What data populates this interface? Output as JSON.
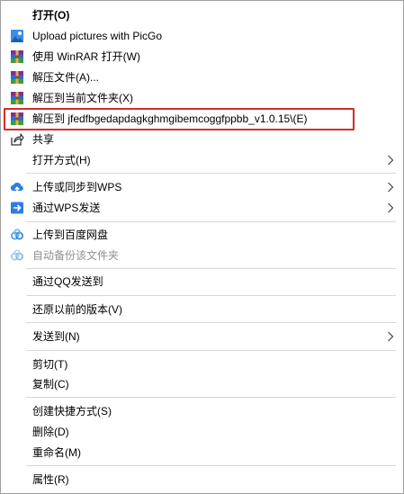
{
  "menu": {
    "items": [
      {
        "id": "open",
        "label": "打开(O)"
      },
      {
        "id": "picgo",
        "label": "Upload pictures with PicGo"
      },
      {
        "id": "winrar-open",
        "label": "使用 WinRAR 打开(W)"
      },
      {
        "id": "extract-files",
        "label": "解压文件(A)..."
      },
      {
        "id": "extract-here",
        "label": "解压到当前文件夹(X)"
      },
      {
        "id": "extract-to-folder",
        "label": "解压到 jfedfbgedapdagkghmgibemcoggfppbb_v1.0.15\\(E)"
      },
      {
        "id": "share",
        "label": "共享"
      },
      {
        "id": "open-with",
        "label": "打开方式(H)"
      },
      {
        "id": "wps-upload",
        "label": "上传或同步到WPS"
      },
      {
        "id": "wps-send",
        "label": "通过WPS发送"
      },
      {
        "id": "baidu-upload",
        "label": "上传到百度网盘"
      },
      {
        "id": "baidu-backup",
        "label": "自动备份该文件夹"
      },
      {
        "id": "qq-send",
        "label": "通过QQ发送到"
      },
      {
        "id": "restore",
        "label": "还原以前的版本(V)"
      },
      {
        "id": "send-to",
        "label": "发送到(N)"
      },
      {
        "id": "cut",
        "label": "剪切(T)"
      },
      {
        "id": "copy",
        "label": "复制(C)"
      },
      {
        "id": "create-shortcut",
        "label": "创建快捷方式(S)"
      },
      {
        "id": "delete",
        "label": "删除(D)"
      },
      {
        "id": "rename",
        "label": "重命名(M)"
      },
      {
        "id": "properties",
        "label": "属性(R)"
      }
    ]
  },
  "colors": {
    "highlight_border": "#d62b2b",
    "separator": "#d7d7d7",
    "disabled_text": "#8f8f8f",
    "wps_blue": "#2e7de1",
    "baidu_blue": "#4fa3e8"
  },
  "icons": {
    "picgo": "picgo-icon",
    "winrar": "winrar-icon",
    "share": "share-icon",
    "wps_upload": "cloud-upload-icon",
    "wps_send": "send-arrow-icon",
    "baidu": "baidu-netdisk-icon",
    "submenu": "chevron-right-icon"
  }
}
